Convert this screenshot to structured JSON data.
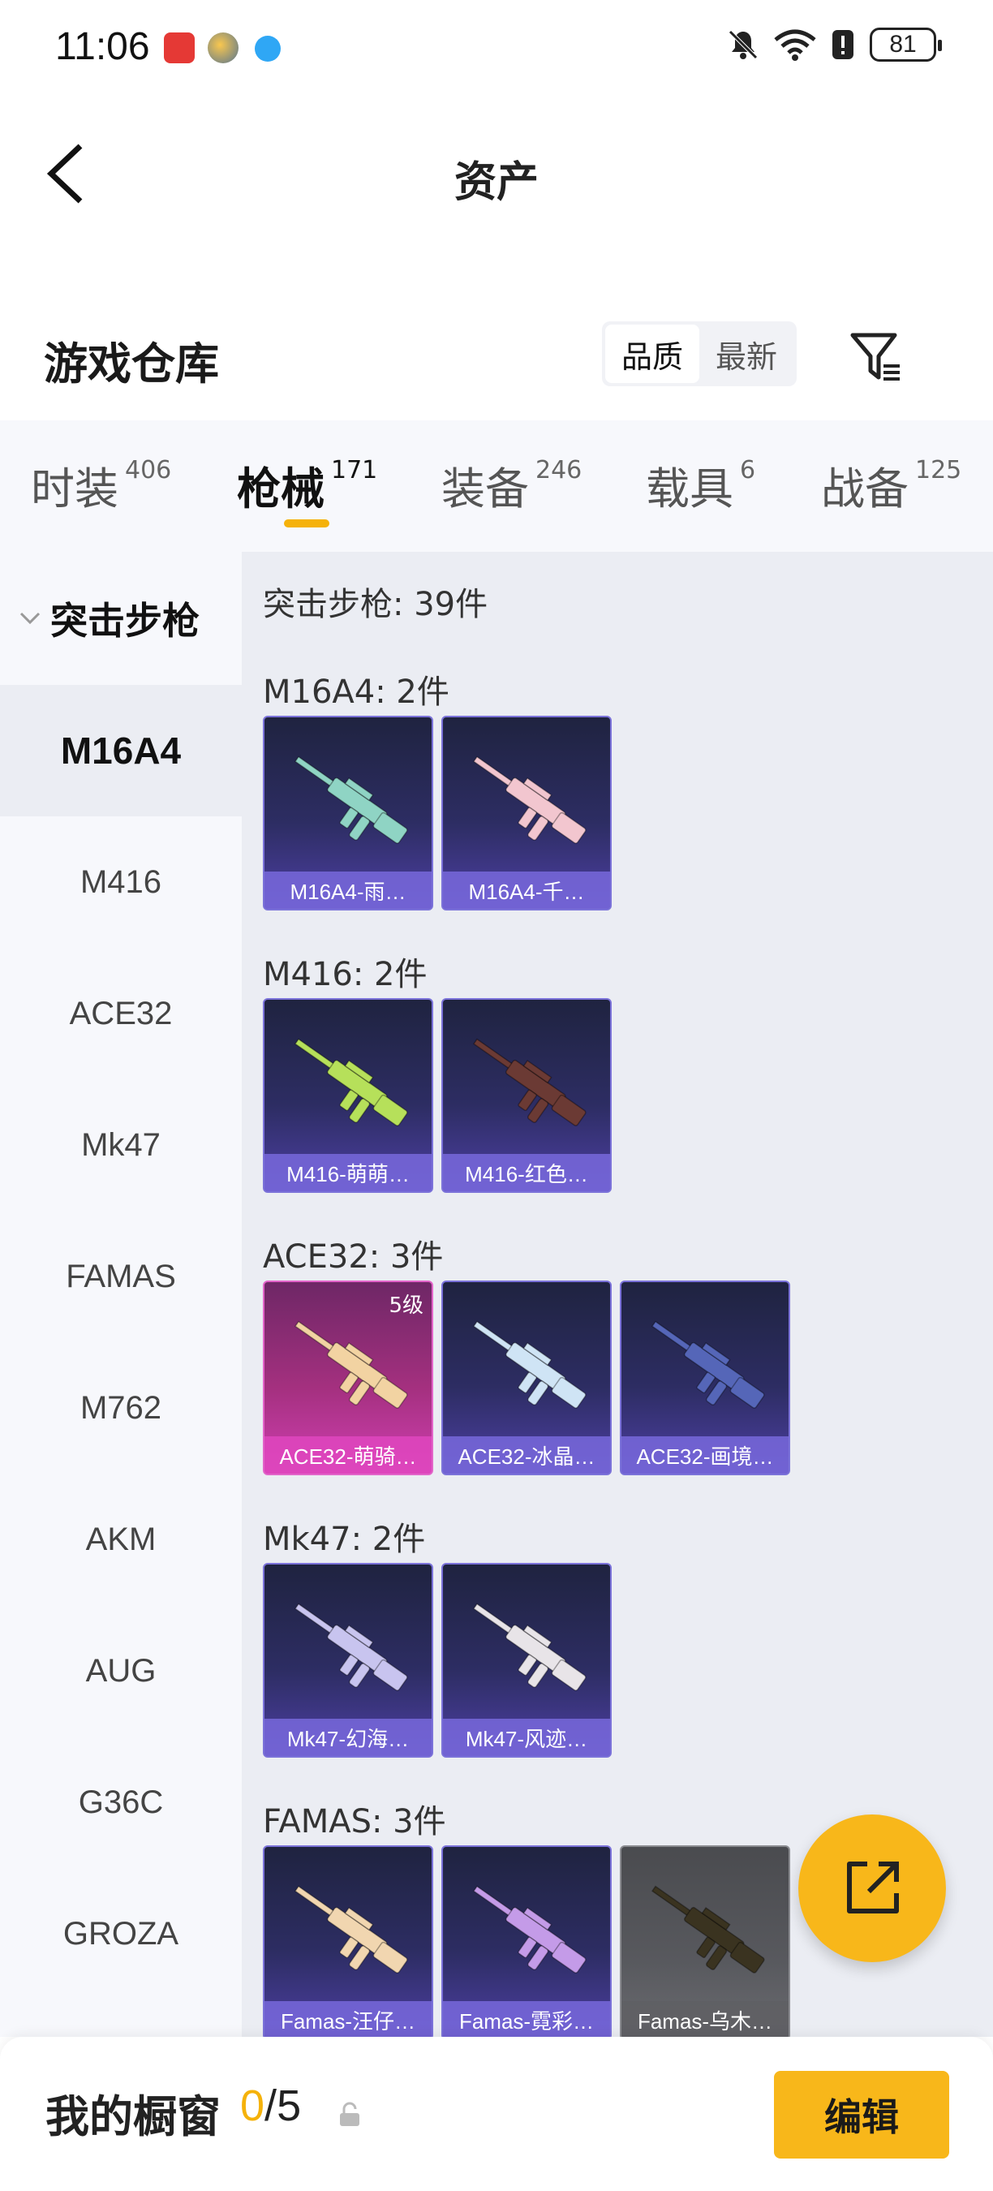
{
  "status_bar": {
    "time": "11:06",
    "battery": "81"
  },
  "header": {
    "title": "资产"
  },
  "warehouse": {
    "title": "游戏仓库",
    "sort_options": [
      "品质",
      "最新"
    ],
    "active_sort": "品质"
  },
  "tabs": [
    {
      "label": "时装",
      "count": "406"
    },
    {
      "label": "枪械",
      "count": "171",
      "active": true
    },
    {
      "label": "装备",
      "count": "246"
    },
    {
      "label": "载具",
      "count": "6"
    },
    {
      "label": "战备",
      "count": "125"
    }
  ],
  "sidebar": {
    "group_label": "突击步枪",
    "items": [
      "M16A4",
      "M416",
      "ACE32",
      "Mk47",
      "FAMAS",
      "M762",
      "AKM",
      "AUG",
      "G36C",
      "GROZA"
    ],
    "active_item": "M16A4"
  },
  "content": {
    "summary": "突击步枪: 39件",
    "sections": [
      {
        "heading": "M16A4: 2件",
        "items": [
          {
            "name": "M16A4-雨…",
            "rarity": "purple",
            "gun_color": "#8fd4c4"
          },
          {
            "name": "M16A4-千…",
            "rarity": "purple",
            "gun_color": "#f2c6cf"
          }
        ]
      },
      {
        "heading": "M416: 2件",
        "items": [
          {
            "name": "M416-萌萌…",
            "rarity": "purple",
            "gun_color": "#b6e05a"
          },
          {
            "name": "M416-红色…",
            "rarity": "purple",
            "gun_color": "#6b3a34"
          }
        ]
      },
      {
        "heading": "ACE32: 3件",
        "items": [
          {
            "name": "ACE32-萌骑…",
            "rarity": "pink",
            "gun_color": "#f2d3a2",
            "level": "5级"
          },
          {
            "name": "ACE32-冰晶…",
            "rarity": "purple",
            "gun_color": "#cfe4f5"
          },
          {
            "name": "ACE32-画境…",
            "rarity": "purple",
            "gun_color": "#5566b8"
          }
        ]
      },
      {
        "heading": "Mk47: 2件",
        "items": [
          {
            "name": "Mk47-幻海…",
            "rarity": "purple",
            "gun_color": "#c8c4ef"
          },
          {
            "name": "Mk47-风迹…",
            "rarity": "purple",
            "gun_color": "#e8e4e8"
          }
        ]
      },
      {
        "heading": "FAMAS: 3件",
        "items": [
          {
            "name": "Famas-汪仔…",
            "rarity": "purple",
            "gun_color": "#f1d6b0"
          },
          {
            "name": "Famas-霓彩…",
            "rarity": "purple",
            "gun_color": "#c49be8"
          },
          {
            "name": "Famas-乌木…",
            "rarity": "gray",
            "gun_color": "#3a3320"
          }
        ]
      }
    ]
  },
  "showcase": {
    "label": "我的橱窗",
    "current": "0",
    "separator": "/",
    "max": "5",
    "edit_label": "编辑"
  },
  "colors": {
    "accent": "#f8b71a",
    "purple_card": "#7b72d9",
    "pink_card": "#e264c9"
  }
}
